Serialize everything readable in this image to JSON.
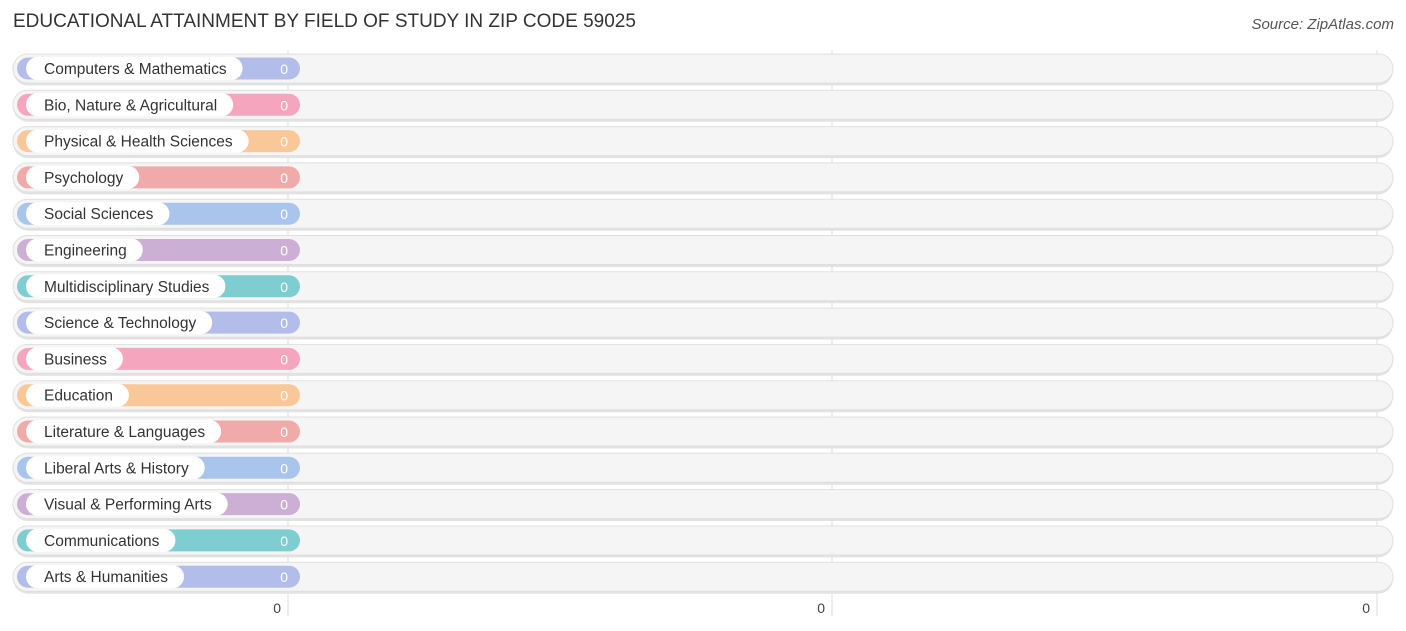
{
  "header": {
    "title": "EDUCATIONAL ATTAINMENT BY FIELD OF STUDY IN ZIP CODE 59025",
    "source": "Source: ZipAtlas.com"
  },
  "chart_data": {
    "type": "bar",
    "orientation": "horizontal",
    "title": "EDUCATIONAL ATTAINMENT BY FIELD OF STUDY IN ZIP CODE 59025",
    "xlabel": "",
    "ylabel": "",
    "grid": true,
    "x_ticks": [
      "0",
      "0",
      "0"
    ],
    "categories": [
      "Computers & Mathematics",
      "Bio, Nature & Agricultural",
      "Physical & Health Sciences",
      "Psychology",
      "Social Sciences",
      "Engineering",
      "Multidisciplinary Studies",
      "Science & Technology",
      "Business",
      "Education",
      "Literature & Languages",
      "Liberal Arts & History",
      "Visual & Performing Arts",
      "Communications",
      "Arts & Humanities"
    ],
    "values": [
      0,
      0,
      0,
      0,
      0,
      0,
      0,
      0,
      0,
      0,
      0,
      0,
      0,
      0,
      0
    ],
    "value_labels": [
      "0",
      "0",
      "0",
      "0",
      "0",
      "0",
      "0",
      "0",
      "0",
      "0",
      "0",
      "0",
      "0",
      "0",
      "0"
    ],
    "colors": [
      "#b3bdea",
      "#f6a5bf",
      "#fac898",
      "#f0aaa9",
      "#a9c5ec",
      "#cdafd6",
      "#7ecdd1",
      "#b3bdea",
      "#f6a5bf",
      "#fac898",
      "#f0aaa9",
      "#a9c5ec",
      "#cdafd6",
      "#7ecdd1",
      "#b3bdea"
    ]
  }
}
